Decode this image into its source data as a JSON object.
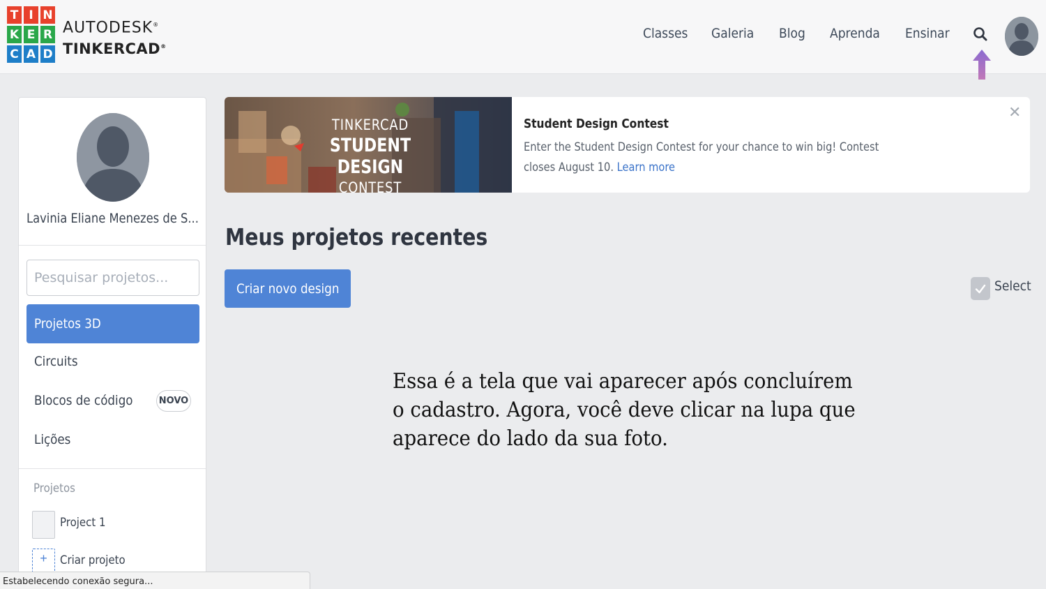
{
  "header": {
    "logo_letters": [
      "T",
      "I",
      "N",
      "K",
      "E",
      "R",
      "C",
      "A",
      "D"
    ],
    "logo_colors": [
      "#e8412c",
      "#e8412c",
      "#e8412c",
      "#2aa74a",
      "#2aa74a",
      "#2aa74a",
      "#1e7ec8",
      "#1e7ec8",
      "#1e7ec8"
    ],
    "brand_top": "AUTODESK",
    "brand_bottom": "TINKERCAD",
    "nav": {
      "classes": "Classes",
      "galeria": "Galeria",
      "blog": "Blog",
      "aprenda": "Aprenda",
      "ensinar": "Ensinar"
    },
    "search_icon": "magnifier-icon",
    "annotation_arrow_color": "#a56fc4"
  },
  "sidebar": {
    "profile_name": "Lavinia Eliane Menezes de S...",
    "search_placeholder": "Pesquisar projetos...",
    "menu": {
      "projetos_3d": "Projetos 3D",
      "circuits": "Circuits",
      "blocos": "Blocos de código",
      "novo_badge": "NOVO",
      "licoes": "Lições"
    },
    "projects_section": "Projetos",
    "project_1": "Project 1",
    "create_plus": "+",
    "create_project": "Criar projeto"
  },
  "banner": {
    "image_line1": "TINKERCAD",
    "image_line2": "STUDENT DESIGN",
    "image_line3": "CONTEST",
    "title": "Student Design Contest",
    "text": "Enter the Student Design Contest for your chance to win big! Contest closes August 10.",
    "link": "Learn more",
    "close": "✕"
  },
  "main": {
    "title": "Meus projetos recentes",
    "create_button": "Criar novo design",
    "select_label": "Select"
  },
  "note": "Essa é a tela que vai aparecer após concluírem o cadastro. Agora, você deve clicar na lupa que aparece do lado da sua foto.",
  "status_bar": "Estabelecendo conexão segura...",
  "colors": {
    "accent_blue": "#4f84d6",
    "link_blue": "#3b73c9"
  }
}
